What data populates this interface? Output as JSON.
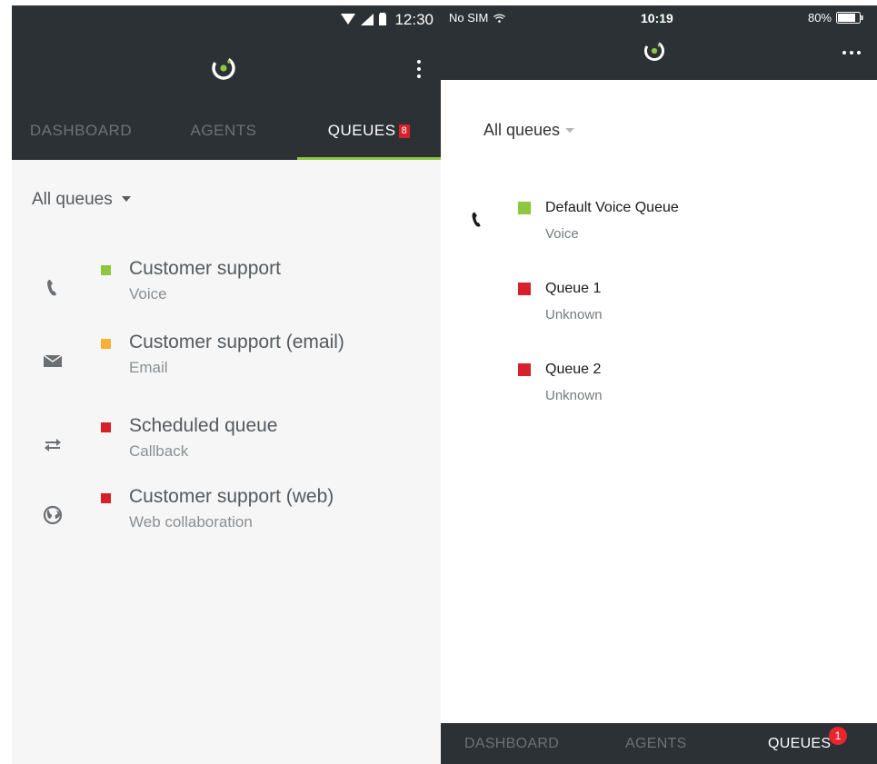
{
  "colors": {
    "header_bg": "#2c3135",
    "status_green": "#8dc63f",
    "status_yellow": "#fbb034",
    "status_red": "#d6202a",
    "tab_active_underline": "#8dc63f"
  },
  "android": {
    "status_bar": {
      "time": "12:30",
      "icons": [
        "wifi-icon",
        "signal-icon",
        "battery-icon"
      ]
    },
    "app_bar": {
      "logo_icon": "app-logo-icon",
      "menu_icon": "overflow-menu-icon"
    },
    "tabs": [
      {
        "label": "DASHBOARD"
      },
      {
        "label": "AGENTS"
      },
      {
        "label": "QUEUES",
        "badge": "8",
        "active": true
      }
    ],
    "filter": {
      "label": "All queues"
    },
    "queues": [
      {
        "name": "Customer support",
        "type": "Voice",
        "status": "green",
        "icon": "phone-icon"
      },
      {
        "name": "Customer support (email)",
        "type": "Email",
        "status": "yellow",
        "icon": "envelope-icon"
      },
      {
        "name": "Scheduled queue",
        "type": "Callback",
        "status": "red",
        "icon": "callback-arrows-icon"
      },
      {
        "name": "Customer support (web)",
        "type": "Web collaboration",
        "status": "red",
        "icon": "globe-icon"
      }
    ]
  },
  "ios": {
    "status_bar": {
      "carrier": "No SIM",
      "time": "10:19",
      "battery": "80%"
    },
    "app_bar": {
      "logo_icon": "app-logo-icon",
      "menu_icon": "more-dots-icon"
    },
    "filter": {
      "label": "All queues"
    },
    "queues": [
      {
        "name": "Default Voice Queue",
        "type": "Voice",
        "status": "green",
        "icon": "phone-icon"
      },
      {
        "name": "Queue 1",
        "type": "Unknown",
        "status": "red"
      },
      {
        "name": "Queue 2",
        "type": "Unknown",
        "status": "red"
      }
    ],
    "tabs": [
      {
        "label": "DASHBOARD"
      },
      {
        "label": "AGENTS"
      },
      {
        "label": "QUEUES",
        "badge": "1",
        "active": true
      }
    ]
  }
}
